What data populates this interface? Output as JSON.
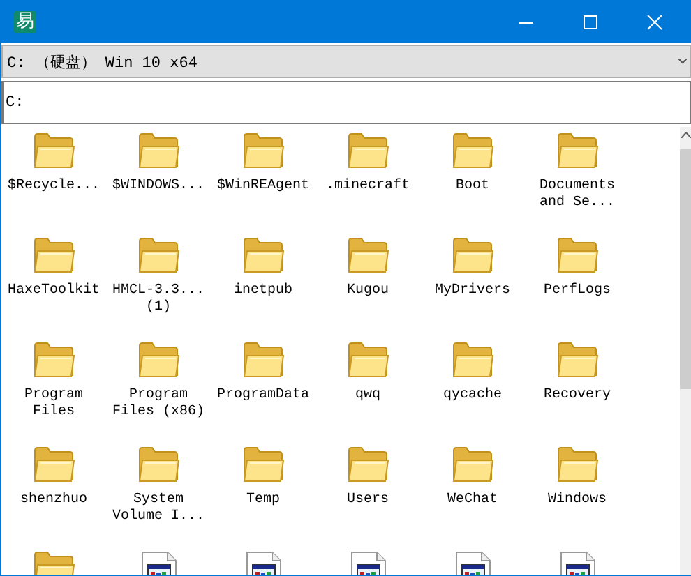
{
  "window": {
    "app_icon_glyph": "易"
  },
  "drive_select": {
    "value": "C: （硬盘） Win 10 x64"
  },
  "path_field": {
    "value": "C:"
  },
  "items": [
    {
      "kind": "folder",
      "label": "$Recycle..."
    },
    {
      "kind": "folder",
      "label": "$WINDOWS..."
    },
    {
      "kind": "folder",
      "label": "$WinREAgent"
    },
    {
      "kind": "folder",
      "label": ".minecraft"
    },
    {
      "kind": "folder",
      "label": "Boot"
    },
    {
      "kind": "folder",
      "label": "Documents and Se..."
    },
    {
      "kind": "folder",
      "label": "HaxeToolkit"
    },
    {
      "kind": "folder",
      "label": "HMCL-3.3... (1)"
    },
    {
      "kind": "folder",
      "label": "inetpub"
    },
    {
      "kind": "folder",
      "label": "Kugou"
    },
    {
      "kind": "folder",
      "label": "MyDrivers"
    },
    {
      "kind": "folder",
      "label": "PerfLogs"
    },
    {
      "kind": "folder",
      "label": "Program Files"
    },
    {
      "kind": "folder",
      "label": "Program Files (x86)"
    },
    {
      "kind": "folder",
      "label": "ProgramData"
    },
    {
      "kind": "folder",
      "label": "qwq"
    },
    {
      "kind": "folder",
      "label": "qycache"
    },
    {
      "kind": "folder",
      "label": "Recovery"
    },
    {
      "kind": "folder",
      "label": "shenzhuo"
    },
    {
      "kind": "folder",
      "label": "System Volume I..."
    },
    {
      "kind": "folder",
      "label": "Temp"
    },
    {
      "kind": "folder",
      "label": "Users"
    },
    {
      "kind": "folder",
      "label": "WeChat"
    },
    {
      "kind": "folder",
      "label": "Windows"
    },
    {
      "kind": "folder"
    },
    {
      "kind": "app"
    },
    {
      "kind": "app"
    },
    {
      "kind": "app"
    },
    {
      "kind": "app"
    },
    {
      "kind": "app"
    }
  ]
}
